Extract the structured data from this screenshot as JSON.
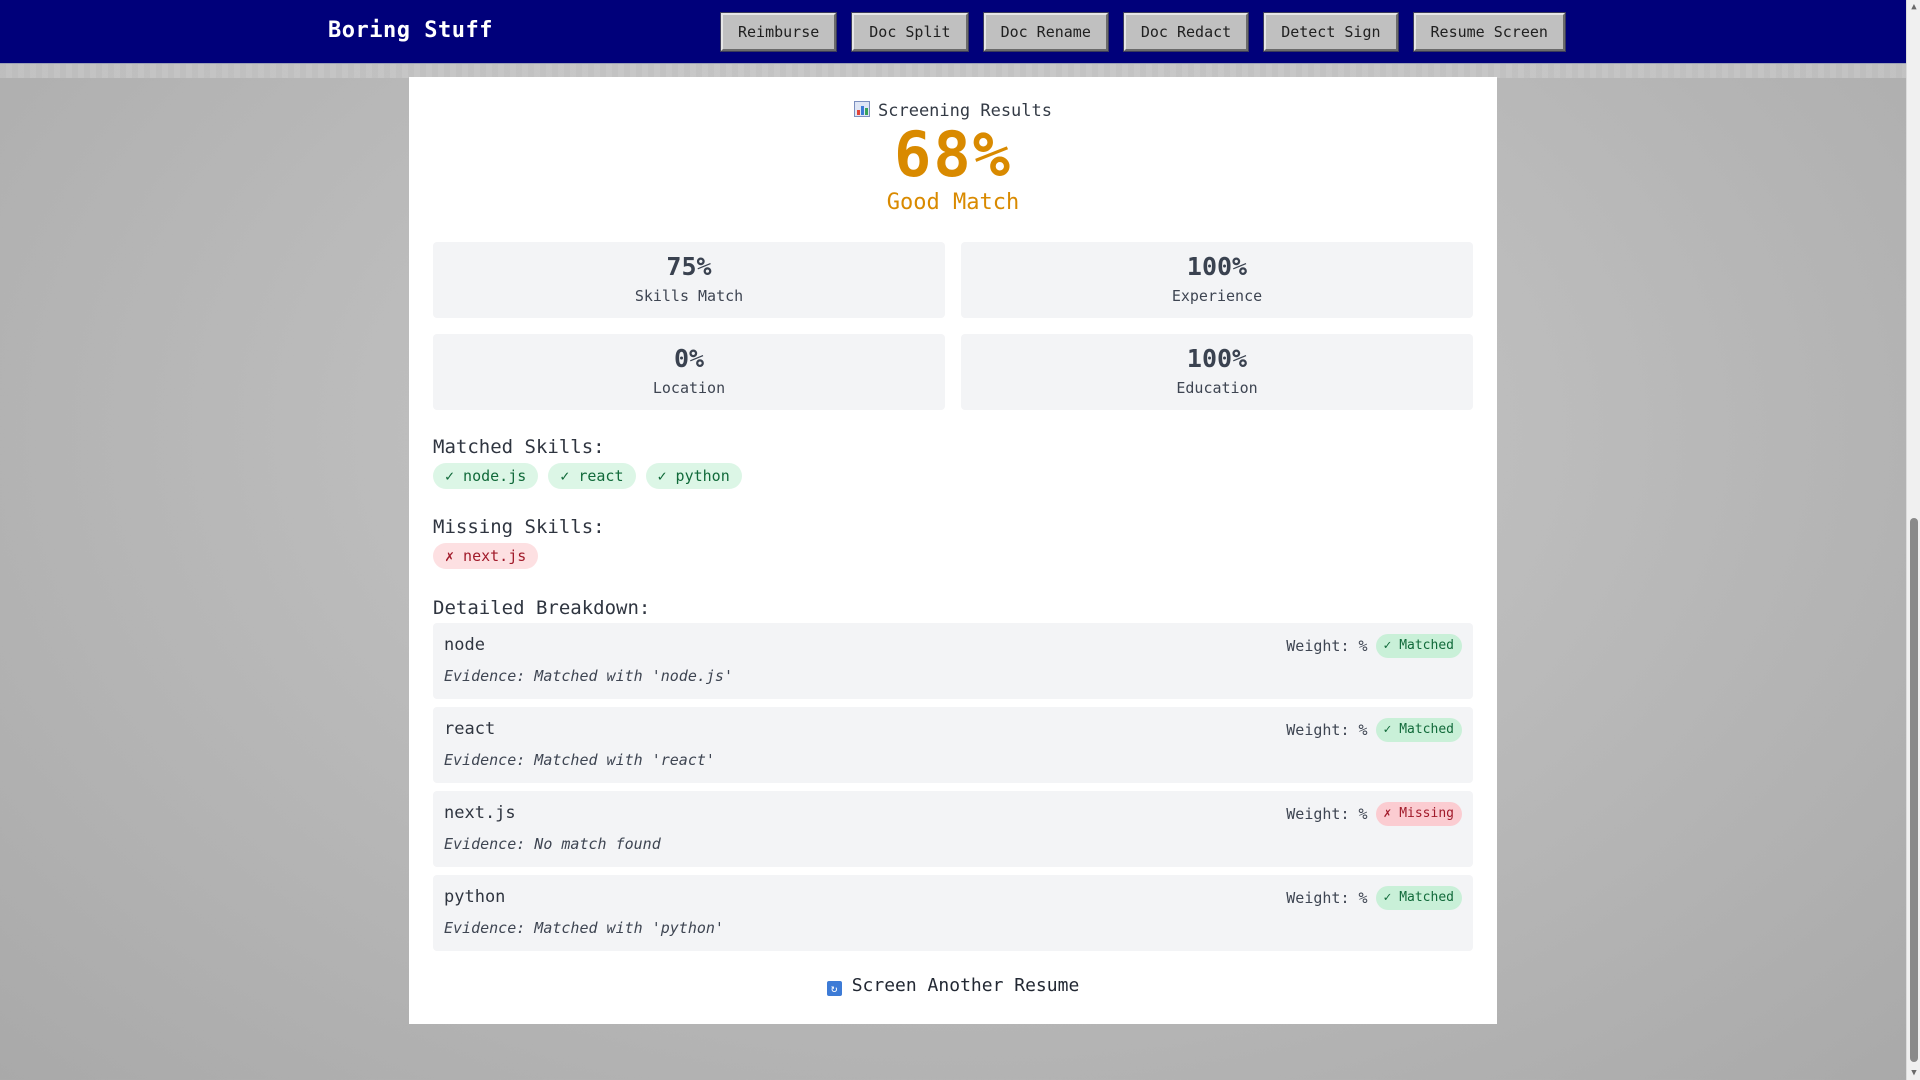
{
  "navbar": {
    "brand": "Boring Stuff",
    "buttons": [
      "Reimburse",
      "Doc Split",
      "Doc Rename",
      "Doc Redact",
      "Detect Sign",
      "Resume Screen"
    ]
  },
  "results": {
    "header": "Screening Results",
    "header_icon": "bar-chart-icon",
    "overall_score": "68%",
    "overall_label": "Good Match",
    "score_color": "#d98a00",
    "metrics": [
      {
        "value": "75%",
        "label": "Skills Match"
      },
      {
        "value": "100%",
        "label": "Experience"
      },
      {
        "value": "0%",
        "label": "Location"
      },
      {
        "value": "100%",
        "label": "Education"
      }
    ]
  },
  "matched_skills": {
    "title": "Matched Skills:",
    "items": [
      "✓ node.js",
      "✓ react",
      "✓ python"
    ]
  },
  "missing_skills": {
    "title": "Missing Skills:",
    "items": [
      "✗ next.js"
    ]
  },
  "breakdown": {
    "title": "Detailed Breakdown:",
    "rows": [
      {
        "skill": "node",
        "weight": "Weight: %",
        "status": "✓ Matched",
        "evidence": "Evidence: Matched with 'node.js'"
      },
      {
        "skill": "react",
        "weight": "Weight: %",
        "status": "✓ Matched",
        "evidence": "Evidence: Matched with 'react'"
      },
      {
        "skill": "next.js",
        "weight": "Weight: %",
        "status": "✗ Missing",
        "evidence": "Evidence: No match found"
      },
      {
        "skill": "python",
        "weight": "Weight: %",
        "status": "✓ Matched",
        "evidence": "Evidence: Matched with 'python'"
      }
    ]
  },
  "actions": {
    "screen_another": "Screen Another Resume",
    "screen_another_icon": "refresh-icon"
  },
  "colors": {
    "navbar": "#00007a",
    "matched": "#116a3a",
    "missing": "#a11a2a"
  }
}
